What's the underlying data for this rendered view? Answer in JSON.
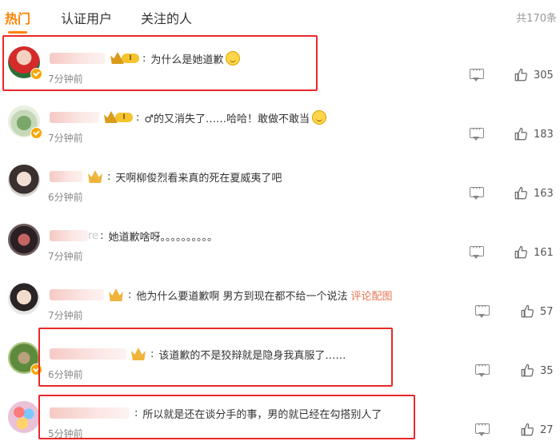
{
  "tabs": [
    {
      "label": "热门",
      "active": true
    },
    {
      "label": "认证用户",
      "active": false
    },
    {
      "label": "关注的人",
      "active": false
    }
  ],
  "total_label": "共170条",
  "accent_color": "#ff8200",
  "highlight_color": "#e8282b",
  "comments": [
    {
      "text": "为什么是她道歉",
      "time": "7分钟前",
      "likes": "305",
      "has_emoji": true,
      "highlighted": true
    },
    {
      "text": "♂的又消失了……哈哈！敢做不敢当",
      "time": "7分钟前",
      "likes": "183",
      "has_emoji": true,
      "highlighted": false
    },
    {
      "text": "天啊柳俊烈看来真的死在夏威夷了吧",
      "time": "6分钟前",
      "likes": "163",
      "highlighted": false
    },
    {
      "text": "她道歉啥呀。。。。。。。。。。",
      "name_suffix": "re",
      "time": "7分钟前",
      "likes": "161",
      "highlighted": false
    },
    {
      "text": "他为什么要道歉啊 男方到现在都不给一个说法",
      "link": "评论配图",
      "time": "7分钟前",
      "likes": "57",
      "highlighted": false
    },
    {
      "text": "该道歉的不是狡辩就是隐身我真服了……",
      "time": "6分钟前",
      "likes": "35",
      "highlighted": true
    },
    {
      "text": "所以就是还在谈分手的事，男的就已经在勾搭别人了",
      "time": "5分钟前",
      "likes": "27",
      "highlighted": true
    }
  ],
  "icons": {
    "reply": "comment-icon",
    "like": "thumbs-up-icon",
    "verified": "verified-badge-icon",
    "vip": "crown-badge-icon"
  }
}
